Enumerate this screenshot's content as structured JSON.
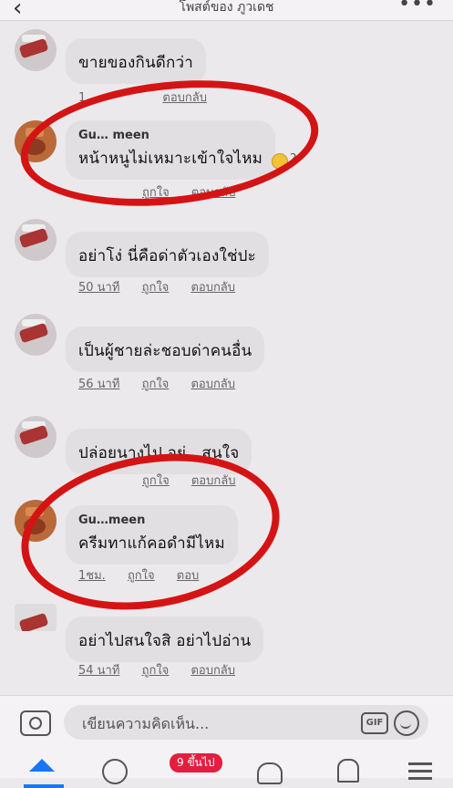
{
  "header": {
    "back_icon": "back-arrow-icon",
    "title": "โพสต์ของ ภูวเดช",
    "more_icon": "more-icon"
  },
  "comments": [
    {
      "name": "",
      "text": "ขายของกินดีกว่า",
      "time": "1",
      "like": "",
      "reply": "ตอบกลับ"
    },
    {
      "name": "Gu… meen",
      "text": "หน้าหนูไม่เหมาะเข้าใจไหม",
      "time": "",
      "like": "ถูกใจ",
      "reply": "ตอบกลับ",
      "reactions": "2"
    },
    {
      "name": "",
      "text": "อย่าโง่ นี่คือด่าตัวเองใช่ปะ",
      "time": "50 นาที",
      "like": "ถูกใจ",
      "reply": "ตอบกลับ"
    },
    {
      "name": "",
      "text": "เป็นผู้ชายล่ะชอบด่าคนอื่น",
      "time": "56 นาที",
      "like": "ถูกใจ",
      "reply": "ตอบกลับ"
    },
    {
      "name": "",
      "text": "ปล่อยนางไป อย่…สนใจ",
      "time": "",
      "like": "ถูกใจ",
      "reply": "ตอบกลับ"
    },
    {
      "name": "Gu…meen",
      "text": "ครีมทาแก้คอดำมีไหม",
      "time": "1ชม.",
      "like": "ถูกใจ",
      "reply": "ตอบ"
    },
    {
      "name": "",
      "text": "อย่าไปสนใจสิ อย่าไปอ่าน",
      "time": "54 นาที",
      "like": "ถูกใจ",
      "reply": "ตอบกลับ"
    }
  ],
  "composer": {
    "placeholder": "เขียนความคิดเห็น...",
    "gif_label": "GIF"
  },
  "nav": {
    "notifications_badge": "9 ขึ้นไป"
  },
  "colors": {
    "accent": "#1877f2",
    "highlight_circle": "#d41414",
    "badge": "#e41e3f"
  }
}
